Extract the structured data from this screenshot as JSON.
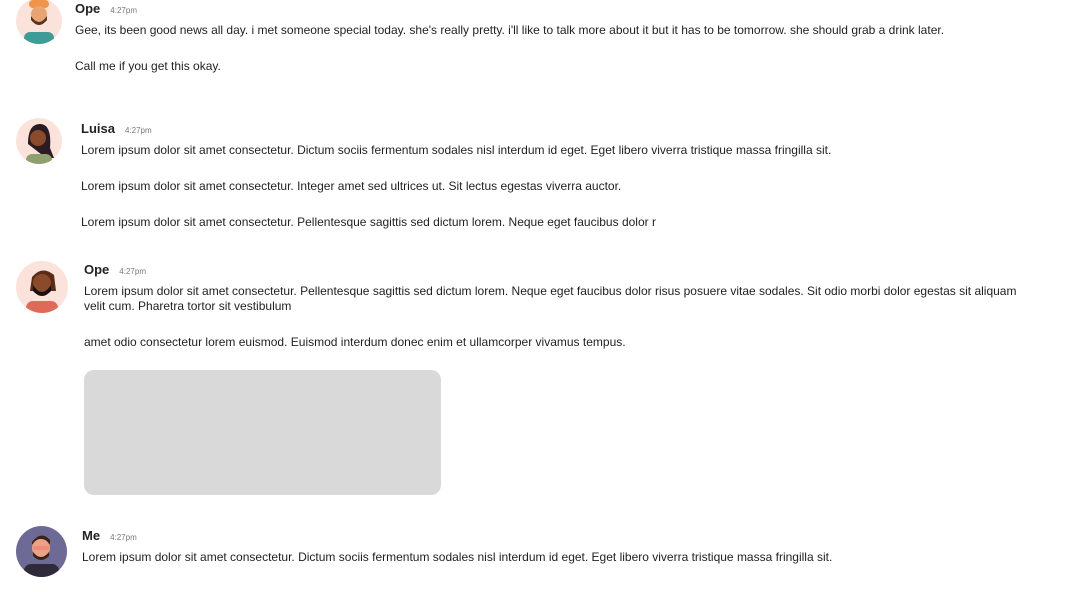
{
  "messages": [
    {
      "name": "Ope",
      "time": "4:27pm",
      "avatar": "avatar-ope-1",
      "paragraphs": [
        "Gee, its been good news all day. i met someone special today. she's really pretty. i'll like to talk more about it but it has to be tomorrow. she should grab a drink later.",
        "Call me if you get this okay."
      ]
    },
    {
      "name": "Luisa",
      "time": "4:27pm",
      "avatar": "avatar-luisa",
      "paragraphs": [
        "Lorem ipsum dolor sit amet consectetur. Dictum sociis fermentum sodales nisl interdum id eget. Eget libero viverra tristique massa fringilla sit.",
        "Lorem ipsum dolor sit amet consectetur. Integer amet sed ultrices ut. Sit lectus egestas viverra auctor.",
        "Lorem ipsum dolor sit amet consectetur. Pellentesque sagittis sed dictum lorem. Neque eget faucibus dolor r"
      ]
    },
    {
      "name": "Ope",
      "time": "4:27pm",
      "avatar": "avatar-ope-2",
      "paragraphs": [
        "Lorem ipsum dolor sit amet consectetur. Pellentesque sagittis sed dictum lorem. Neque eget faucibus dolor risus posuere vitae sodales. Sit odio morbi dolor egestas sit aliquam velit cum. Pharetra tortor sit vestibulum",
        "amet odio consectetur lorem euismod. Euismod interdum donec enim et ullamcorper vivamus tempus."
      ]
    },
    {
      "name": "Me",
      "time": "4:27pm",
      "avatar": "avatar-me",
      "paragraphs": [
        "Lorem ipsum dolor sit amet consectetur. Dictum sociis fermentum sodales nisl interdum id eget. Eget libero viverra tristique massa fringilla sit."
      ]
    }
  ],
  "colors": {
    "image_placeholder": "#d9d9d9"
  }
}
